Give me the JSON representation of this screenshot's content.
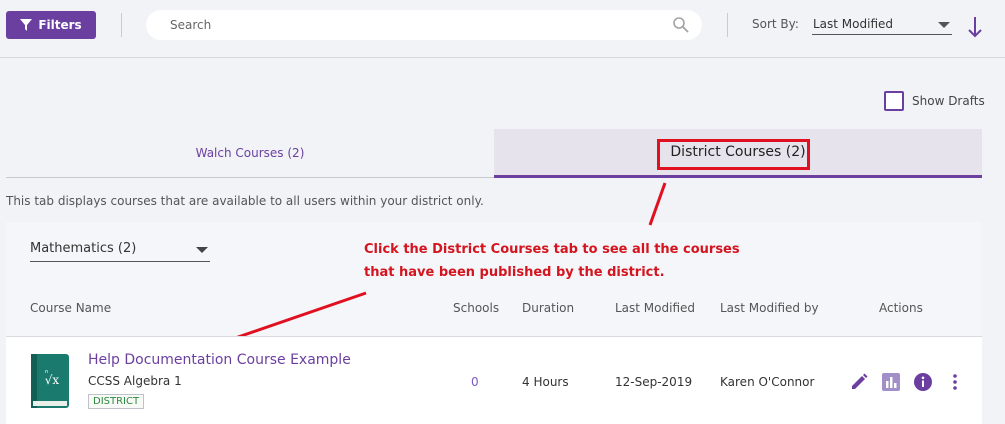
{
  "toolbar": {
    "filters_label": "Filters",
    "search_placeholder": "Search",
    "sort_label": "Sort By:",
    "sort_value": "Last Modified"
  },
  "drafts": {
    "label": "Show Drafts",
    "checked": false
  },
  "tabs": [
    {
      "label": "Walch Courses (2)",
      "active": false
    },
    {
      "label": "District Courses (2)",
      "active": true
    }
  ],
  "tab_description": "This tab displays courses that are available to all users within your district only.",
  "subject": {
    "value": "Mathematics (2)"
  },
  "annotation": {
    "line1": "Click the District Courses tab to see all the courses",
    "line2": "that have been published by the district."
  },
  "table": {
    "columns": [
      "Course Name",
      "Schools",
      "Duration",
      "Last Modified",
      "Last Modified by",
      "Actions"
    ],
    "rows": [
      {
        "title": "Help Documentation Course Example",
        "subtitle": "CCSS Algebra 1",
        "badge": "DISTRICT",
        "schools": "0",
        "duration": "4 Hours",
        "last_modified": "12-Sep-2019",
        "modified_by": "Karen O'Connor"
      }
    ]
  },
  "colors": {
    "accent": "#6b3fa0",
    "annotation": "#e01020",
    "badge_text": "#2d8a3b"
  }
}
